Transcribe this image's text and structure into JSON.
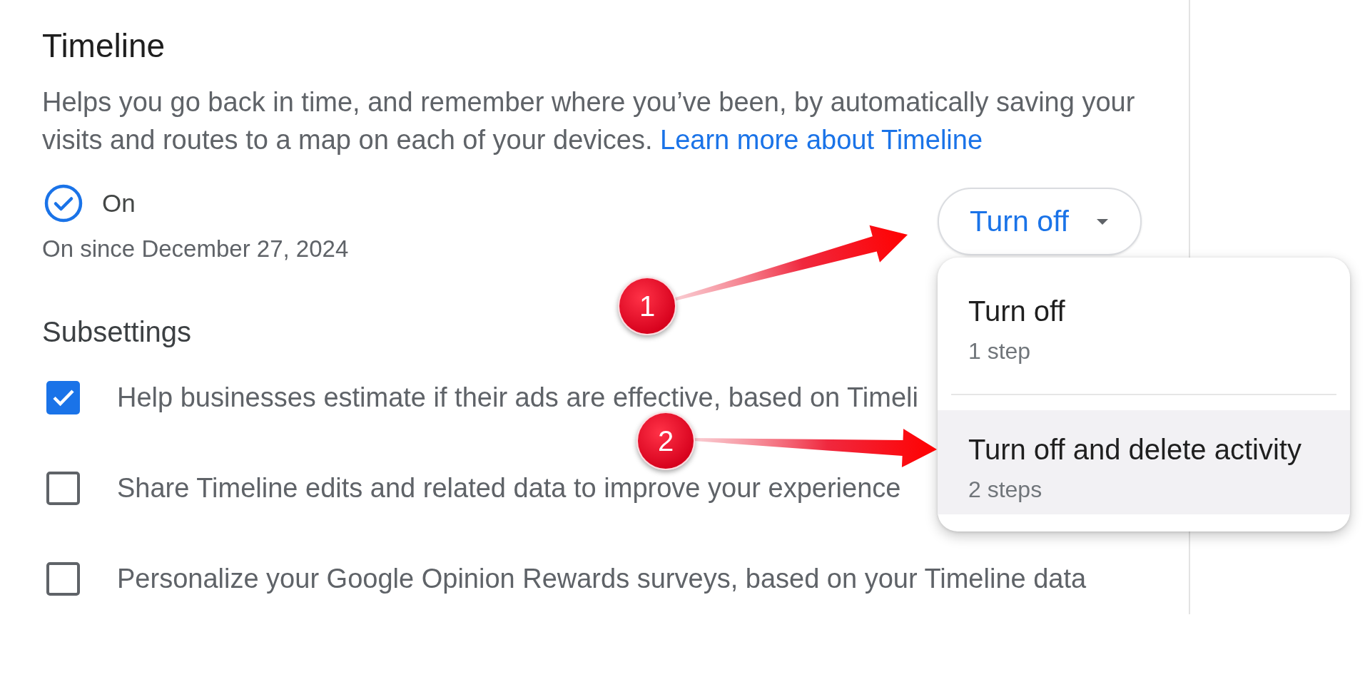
{
  "section": {
    "title": "Timeline",
    "description": "Helps you go back in time, and remember where you’ve been, by automatically saving your visits and routes to a map on each of your devices.",
    "link": "Learn more about Timeline"
  },
  "status": {
    "label": "On",
    "on": true,
    "since": "On since December 27, 2024"
  },
  "turn_off_button": {
    "label": "Turn off",
    "expanded": true
  },
  "menu": {
    "items": [
      {
        "title": "Turn off",
        "subtitle": "1 step",
        "selected": false
      },
      {
        "title": "Turn off and delete activity",
        "subtitle": "2 steps",
        "selected": true
      }
    ]
  },
  "subsettings": {
    "heading": "Subsettings",
    "items": [
      {
        "label": "Help businesses estimate if their ads are effective, based on Timeli",
        "checked": true
      },
      {
        "label": "Share Timeline edits and related data to improve your experience",
        "checked": false
      },
      {
        "label": "Personalize your Google Opinion Rewards surveys, based on your Timeline data",
        "checked": false
      }
    ]
  },
  "callouts": [
    {
      "number": "1"
    },
    {
      "number": "2"
    }
  ]
}
